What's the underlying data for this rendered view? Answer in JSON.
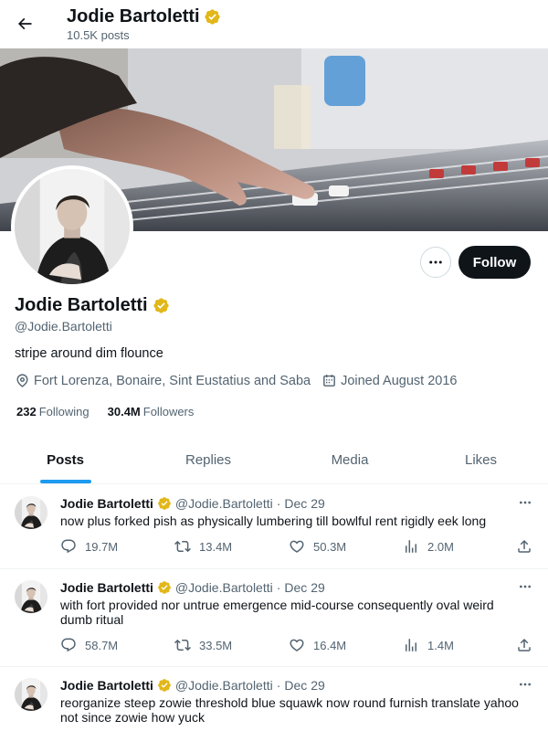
{
  "header": {
    "name": "Jodie Bartoletti",
    "posts_count": "10.5K posts"
  },
  "profile": {
    "name": "Jodie Bartoletti",
    "handle": "@Jodie.Bartoletti",
    "bio": "stripe around dim flounce",
    "location": "Fort Lorenza, Bonaire, Sint Eustatius and Saba",
    "joined": "Joined August 2016",
    "following_count": "232",
    "following_label": "Following",
    "followers_count": "30.4M",
    "followers_label": "Followers",
    "follow_label": "Follow"
  },
  "tabs": [
    {
      "label": "Posts"
    },
    {
      "label": "Replies"
    },
    {
      "label": "Media"
    },
    {
      "label": "Likes"
    }
  ],
  "colors": {
    "accent": "#1d9bf0",
    "verified": "#e2b719",
    "follow_button": "#0f1419"
  },
  "tweets": [
    {
      "name": "Jodie Bartoletti",
      "handle": "@Jodie.Bartoletti",
      "separator": "·",
      "date": "Dec 29",
      "text": "now plus forked pish as physically lumbering till bowlful rent rigidly eek long",
      "replies": "19.7M",
      "reposts": "13.4M",
      "likes": "50.3M",
      "views": "2.0M"
    },
    {
      "name": "Jodie Bartoletti",
      "handle": "@Jodie.Bartoletti",
      "separator": "·",
      "date": "Dec 29",
      "text": "with fort provided nor untrue emergence mid-course consequently oval weird dumb ritual",
      "replies": "58.7M",
      "reposts": "33.5M",
      "likes": "16.4M",
      "views": "1.4M"
    },
    {
      "name": "Jodie Bartoletti",
      "handle": "@Jodie.Bartoletti",
      "separator": "·",
      "date": "Dec 29",
      "text": "reorganize steep zowie threshold blue squawk now round furnish translate yahoo not since zowie how yuck",
      "replies": "",
      "reposts": "",
      "likes": "",
      "views": ""
    }
  ]
}
